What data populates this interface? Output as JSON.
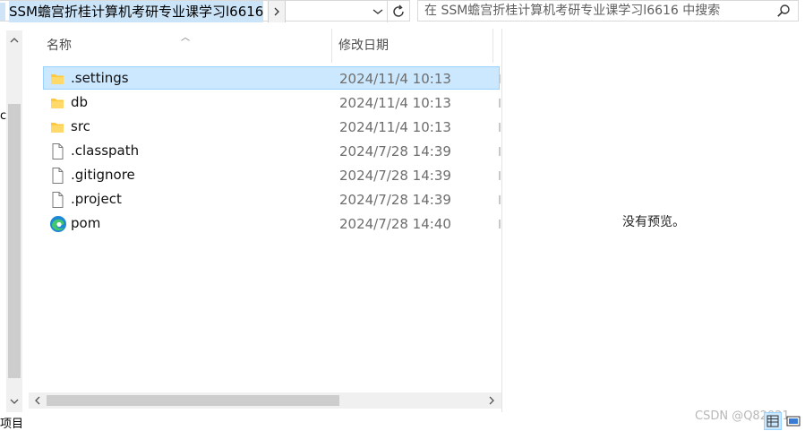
{
  "address_bar": {
    "path_segment": "SSM蟾宫折桂计算机考研专业课学习l6616"
  },
  "search": {
    "placeholder": "在 SSM蟾宫折桂计算机考研专业课学习l6616 中搜索"
  },
  "nav": {
    "fragment": "c"
  },
  "file_list": {
    "columns": {
      "name": "名称",
      "date_modified": "修改日期"
    },
    "rows": [
      {
        "name": ".settings",
        "date": "2024/11/4 10:13",
        "icon": "folder-icon",
        "selected": true
      },
      {
        "name": "db",
        "date": "2024/11/4 10:13",
        "icon": "folder-icon",
        "selected": false
      },
      {
        "name": "src",
        "date": "2024/11/4 10:13",
        "icon": "folder-icon",
        "selected": false
      },
      {
        "name": ".classpath",
        "date": "2024/7/28 14:39",
        "icon": "file-icon",
        "selected": false
      },
      {
        "name": ".gitignore",
        "date": "2024/7/28 14:39",
        "icon": "file-icon",
        "selected": false
      },
      {
        "name": ".project",
        "date": "2024/7/28 14:39",
        "icon": "file-icon",
        "selected": false
      },
      {
        "name": "pom",
        "date": "2024/7/28 14:40",
        "icon": "edge-icon",
        "selected": false
      }
    ]
  },
  "preview": {
    "text": "没有预览。"
  },
  "status_bar": {
    "left_fragment": "项目"
  },
  "watermark": "CSDN @Q82021",
  "colors": {
    "selection_fill": "#cce8ff",
    "selection_border": "#99d1ff",
    "folder": "#ffc83d",
    "address_highlight": "#cce4f7"
  }
}
